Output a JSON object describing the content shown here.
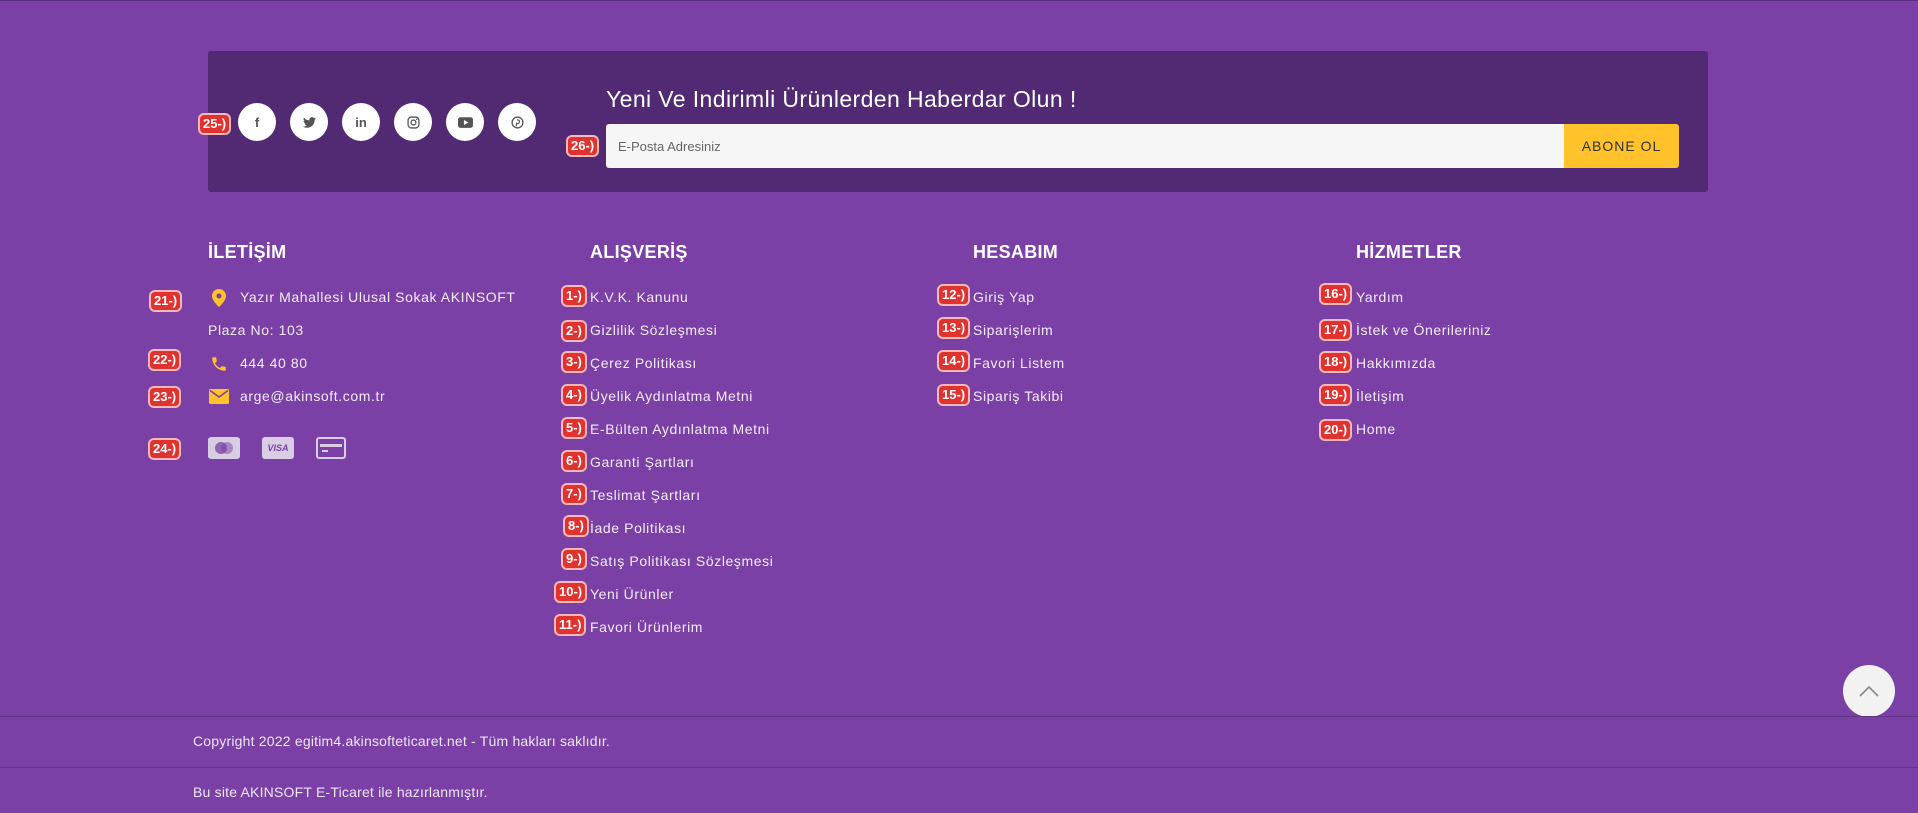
{
  "newsletter": {
    "title": "Yeni Ve Indirimli Ürünlerden Haberdar Olun !",
    "email_placeholder": "E-Posta Adresiniz",
    "email_value": "",
    "subscribe_label": "ABONE OL"
  },
  "social": [
    {
      "name": "facebook",
      "glyph": "f"
    },
    {
      "name": "twitter",
      "glyph": "t"
    },
    {
      "name": "linkedin",
      "glyph": "in"
    },
    {
      "name": "instagram",
      "glyph": "◎"
    },
    {
      "name": "youtube",
      "glyph": "▶"
    },
    {
      "name": "pinterest",
      "glyph": "p"
    }
  ],
  "contact": {
    "heading": "İLETİŞİM",
    "address_line1": "Yazır Mahallesi Ulusal Sokak AKINSOFT",
    "address_line2": "Plaza No: 103",
    "phone": "444 40 80",
    "email": "arge@akinsoft.com.tr",
    "payment_icons": [
      "mastercard-icon",
      "visa-icon",
      "credit-card-icon"
    ],
    "visa_text": "VISA"
  },
  "shopping": {
    "heading": "ALIŞVERİŞ",
    "items": [
      "K.V.K. Kanunu",
      "Gizlilik Sözleşmesi",
      "Çerez Politikası",
      "Üyelik Aydınlatma Metni",
      "E-Bülten Aydınlatma Metni",
      "Garanti Şartları",
      "Teslimat Şartları",
      "İade Politikası",
      "Satış Politikası Sözleşmesi",
      "Yeni Ürünler",
      "Favori Ürünlerim"
    ]
  },
  "account": {
    "heading": "HESABIM",
    "items": [
      "Giriş Yap",
      "Siparişlerim",
      "Favori Listem",
      "Sipariş Takibi"
    ]
  },
  "services": {
    "heading": "HİZMETLER",
    "items": [
      "Yardım",
      "İstek ve Önerileriniz",
      "Hakkımızda",
      "İletişim",
      "Home"
    ]
  },
  "markers": {
    "m1": "1-)",
    "m2": "2-)",
    "m3": "3-)",
    "m4": "4-)",
    "m5": "5-)",
    "m6": "6-)",
    "m7": "7-)",
    "m8": "8-)",
    "m9": "9-)",
    "m10": "10-)",
    "m11": "11-)",
    "m12": "12-)",
    "m13": "13-)",
    "m14": "14-)",
    "m15": "15-)",
    "m16": "16-)",
    "m17": "17-)",
    "m18": "18-)",
    "m19": "19-)",
    "m20": "20-)",
    "m21": "21-)",
    "m22": "22-)",
    "m23": "23-)",
    "m24": "24-)",
    "m25": "25-)",
    "m26": "26-)"
  },
  "footer": {
    "copyright": "Copyright 2022 egitim4.akinsofteticaret.net - Tüm hakları saklıdır.",
    "made_with": "Bu site AKINSOFT E-Ticaret ile hazırlanmıştır."
  },
  "colors": {
    "background": "#7a40a6",
    "panel": "#522a74",
    "accent": "#ffc22a",
    "marker": "#e0332f"
  }
}
